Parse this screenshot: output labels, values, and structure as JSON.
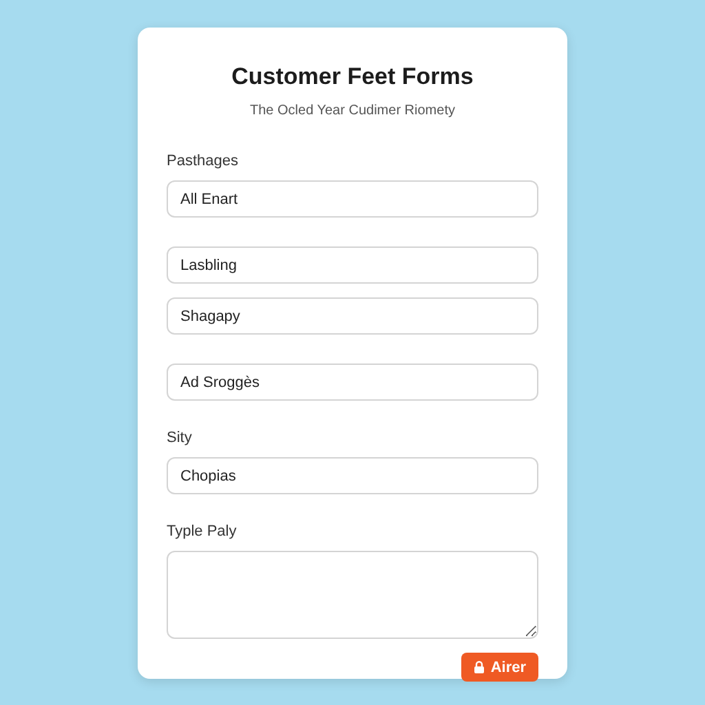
{
  "form": {
    "title": "Customer Feet Forms",
    "subtitle": "The Ocled Year Cudimer Riomety",
    "groups": [
      {
        "label": "Pasthages",
        "fields": [
          {
            "kind": "input",
            "value": "All Enart"
          }
        ]
      },
      {
        "fields": [
          {
            "kind": "input",
            "value": "Lasbling"
          },
          {
            "kind": "input",
            "value": "Shagapy"
          }
        ]
      },
      {
        "fields": [
          {
            "kind": "input",
            "value": "Ad Sroggès"
          }
        ]
      },
      {
        "label": "Sity",
        "fields": [
          {
            "kind": "input",
            "value": "Chopias"
          }
        ]
      },
      {
        "label": "Typle Paly",
        "fields": [
          {
            "kind": "textarea"
          }
        ]
      }
    ],
    "submit": {
      "label": "Airer"
    }
  }
}
